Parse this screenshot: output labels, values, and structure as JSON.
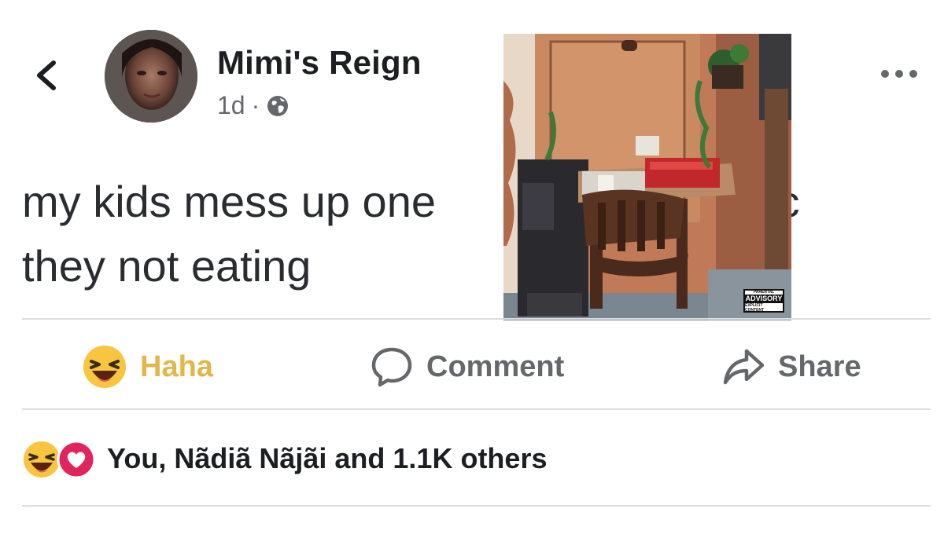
{
  "post": {
    "author": "Mimi's Reign",
    "time": "1d",
    "separator": "·",
    "privacy_icon": "globe-icon",
    "text_line1": "my kids mess up one",
    "text_line1_tail": "lyric",
    "text_line2": "they not eating"
  },
  "album_art": {
    "advisory_top": "PARENTAL",
    "advisory_main": "ADVISORY",
    "advisory_bottom": "EXPLICIT CONTENT"
  },
  "actions": {
    "haha_label": "Haha",
    "comment_label": "Comment",
    "share_label": "Share"
  },
  "reactions": {
    "summary": "You, Nãdiã Nãjãi and 1.1K others",
    "icons": [
      "haha-icon",
      "love-icon"
    ]
  },
  "colors": {
    "haha_active": "#e3b64a",
    "muted": "#65676b",
    "love": "#e0245e",
    "divider": "#dcdde0"
  }
}
